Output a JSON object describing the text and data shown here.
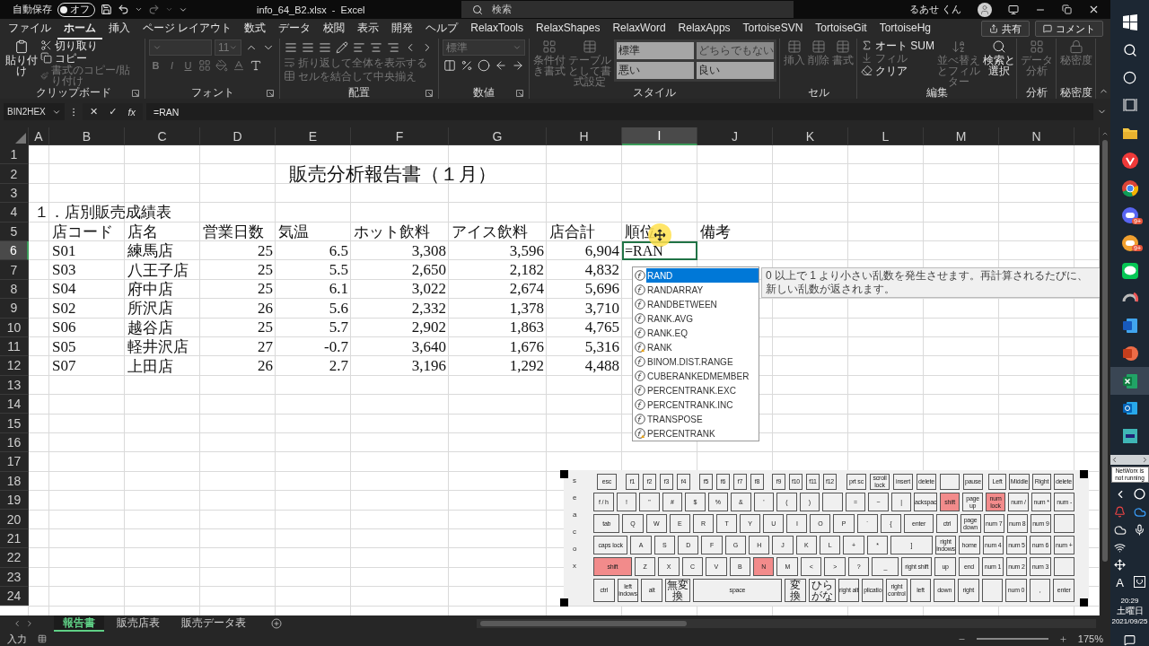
{
  "title_bar": {
    "autosave_label": "自動保存",
    "autosave": {
      "on": false,
      "label": "オフ"
    },
    "title": "info_64_B2.xlsx  -  Excel",
    "search_placeholder": "検索",
    "user": "るあせ くん"
  },
  "ribbon": {
    "tabs": [
      {
        "label": "ファイル",
        "selected": false
      },
      {
        "label": "ホーム",
        "selected": true
      },
      {
        "label": "挿入",
        "selected": false
      },
      {
        "label": "ページ レイアウト",
        "selected": false
      },
      {
        "label": "数式",
        "selected": false
      },
      {
        "label": "データ",
        "selected": false
      },
      {
        "label": "校閲",
        "selected": false
      },
      {
        "label": "表示",
        "selected": false
      },
      {
        "label": "開発",
        "selected": false
      },
      {
        "label": "ヘルプ",
        "selected": false
      },
      {
        "label": "RelaxTools",
        "selected": false
      },
      {
        "label": "RelaxShapes",
        "selected": false
      },
      {
        "label": "RelaxWord",
        "selected": false
      },
      {
        "label": "RelaxApps",
        "selected": false
      },
      {
        "label": "TortoiseSVN",
        "selected": false
      },
      {
        "label": "TortoiseGit",
        "selected": false
      },
      {
        "label": "TortoiseHg",
        "selected": false
      }
    ],
    "share": "共有",
    "comment": "コメント",
    "groups": [
      {
        "label": "クリップボード",
        "items": [
          {
            "kind": "large",
            "label": "貼り付け",
            "disabled": false
          },
          {
            "kind": "small",
            "label": "切り取り",
            "disabled": false
          },
          {
            "kind": "small",
            "label": "コピー",
            "disabled": false
          },
          {
            "kind": "small",
            "label": "書式のコピー/貼り付け",
            "disabled": true
          }
        ]
      },
      {
        "label": "フォント",
        "items": [
          {
            "kind": "field",
            "disabled": true
          },
          {
            "kind": "field",
            "value": "11",
            "disabled": true
          },
          {
            "kind": "icon",
            "disabled": false
          },
          {
            "kind": "icon",
            "disabled": false
          },
          {
            "kind": "text",
            "label": "B",
            "disabled": true
          },
          {
            "kind": "text",
            "label": "I",
            "disabled": true
          },
          {
            "kind": "text",
            "label": "U",
            "disabled": true
          },
          {
            "kind": "icon",
            "disabled": true
          },
          {
            "kind": "icon",
            "disabled": true
          },
          {
            "kind": "icon",
            "disabled": true
          },
          {
            "kind": "icon",
            "disabled": false
          }
        ]
      },
      {
        "label": "配置",
        "items": [
          {
            "kind": "icon",
            "disabled": false
          },
          {
            "kind": "icon",
            "disabled": false
          },
          {
            "kind": "icon",
            "disabled": false
          },
          {
            "kind": "icon",
            "disabled": false
          },
          {
            "kind": "small",
            "label": "折り返して全体を表示する",
            "disabled": true
          },
          {
            "kind": "icon",
            "disabled": false
          },
          {
            "kind": "icon",
            "disabled": false
          },
          {
            "kind": "icon",
            "disabled": false
          },
          {
            "kind": "icon",
            "disabled": false
          },
          {
            "kind": "icon",
            "disabled": false
          },
          {
            "kind": "small",
            "label": "セルを結合して中央揃え",
            "disabled": true
          }
        ]
      },
      {
        "label": "数値",
        "items": [
          {
            "kind": "field",
            "value": "標準",
            "disabled": true
          },
          {
            "kind": "icon",
            "disabled": false
          },
          {
            "kind": "icon",
            "disabled": false
          },
          {
            "kind": "icon",
            "disabled": false
          },
          {
            "kind": "icon",
            "disabled": false
          },
          {
            "kind": "icon",
            "disabled": false
          }
        ]
      },
      {
        "label": "スタイル",
        "items": [
          {
            "kind": "large",
            "label": "条件付き書式",
            "disabled": true
          },
          {
            "kind": "large",
            "label": "テーブルとして書式設定",
            "disabled": true
          },
          {
            "kind": "style",
            "label": "標準",
            "disabled": false
          },
          {
            "kind": "style",
            "label": "どちらでもない",
            "disabled": true
          },
          {
            "kind": "style",
            "label": "悪い",
            "disabled": false
          },
          {
            "kind": "style",
            "label": "良い",
            "disabled": false
          }
        ]
      },
      {
        "label": "セル",
        "items": [
          {
            "kind": "large",
            "label": "挿入",
            "disabled": true
          },
          {
            "kind": "large",
            "label": "削除",
            "disabled": true
          },
          {
            "kind": "large",
            "label": "書式",
            "disabled": true
          }
        ]
      },
      {
        "label": "編集",
        "items": [
          {
            "kind": "small",
            "label": "オート SUM",
            "disabled": false
          },
          {
            "kind": "small",
            "label": "フィル",
            "disabled": true
          },
          {
            "kind": "small",
            "label": "クリア",
            "disabled": false
          },
          {
            "kind": "large",
            "label": "並べ替えとフィルター",
            "disabled": true
          },
          {
            "kind": "large",
            "label": "検索と選択",
            "disabled": false
          }
        ]
      },
      {
        "label": "分析",
        "items": [
          {
            "kind": "large",
            "label": "データ分析",
            "disabled": true
          }
        ]
      },
      {
        "label": "秘密度",
        "items": [
          {
            "kind": "large",
            "label": "秘密度",
            "disabled": true
          }
        ]
      }
    ]
  },
  "formula_bar": {
    "name_box": "BIN2HEX",
    "cancel": "✕",
    "enter": "✓",
    "function": "fx",
    "formula": "=RAN"
  },
  "sheet": {
    "columns": [
      {
        "label": "A",
        "selected": false
      },
      {
        "label": "B",
        "selected": false
      },
      {
        "label": "C",
        "selected": false
      },
      {
        "label": "D",
        "selected": false
      },
      {
        "label": "E",
        "selected": false
      },
      {
        "label": "F",
        "selected": false
      },
      {
        "label": "G",
        "selected": false
      },
      {
        "label": "H",
        "selected": false
      },
      {
        "label": "I",
        "selected": true
      },
      {
        "label": "J",
        "selected": false
      },
      {
        "label": "K",
        "selected": false
      },
      {
        "label": "L",
        "selected": false
      },
      {
        "label": "M",
        "selected": false
      },
      {
        "label": "N",
        "selected": false
      }
    ],
    "rows": [
      {
        "number": "1",
        "kind": "empty",
        "selected": false
      },
      {
        "number": "2",
        "kind": "title",
        "selected": false,
        "E": "販売分析報告書（１月）"
      },
      {
        "number": "3",
        "kind": "empty",
        "selected": false
      },
      {
        "number": "4",
        "kind": "section",
        "selected": false,
        "A": "１．店別販売成績表"
      },
      {
        "number": "5",
        "kind": "header",
        "selected": false,
        "B": "店コード",
        "C": "店名",
        "D": "営業日数",
        "E": "気温",
        "F": "ホット飲料",
        "G": "アイス飲料",
        "H": "店合計",
        "I": "順位",
        "J": "備考"
      },
      {
        "number": "6",
        "kind": "data",
        "selected": true,
        "B": "S01",
        "C": "練馬店",
        "D": "25",
        "E": "6.5",
        "F": "3,308",
        "G": "3,596",
        "H": "6,904",
        "I": "=RAN"
      },
      {
        "number": "7",
        "kind": "data",
        "selected": false,
        "B": "S03",
        "C": "八王子店",
        "D": "25",
        "E": "5.5",
        "F": "2,650",
        "G": "2,182",
        "H": "4,832"
      },
      {
        "number": "8",
        "kind": "data",
        "selected": false,
        "B": "S04",
        "C": "府中店",
        "D": "25",
        "E": "6.1",
        "F": "3,022",
        "G": "2,674",
        "H": "5,696"
      },
      {
        "number": "9",
        "kind": "data",
        "selected": false,
        "B": "S02",
        "C": "所沢店",
        "D": "26",
        "E": "5.6",
        "F": "2,332",
        "G": "1,378",
        "H": "3,710"
      },
      {
        "number": "10",
        "kind": "data",
        "selected": false,
        "B": "S06",
        "C": "越谷店",
        "D": "25",
        "E": "5.7",
        "F": "2,902",
        "G": "1,863",
        "H": "4,765"
      },
      {
        "number": "11",
        "kind": "data",
        "selected": false,
        "B": "S05",
        "C": "軽井沢店",
        "D": "27",
        "E": "-0.7",
        "F": "3,640",
        "G": "1,676",
        "H": "5,316"
      },
      {
        "number": "12",
        "kind": "data",
        "selected": false,
        "B": "S07",
        "C": "上田店",
        "D": "26",
        "E": "2.7",
        "F": "3,196",
        "G": "1,292",
        "H": "4,488"
      },
      {
        "number": "13",
        "kind": "empty",
        "selected": false
      },
      {
        "number": "14",
        "kind": "empty",
        "selected": false
      },
      {
        "number": "15",
        "kind": "empty",
        "selected": false
      },
      {
        "number": "16",
        "kind": "empty",
        "selected": false
      },
      {
        "number": "17",
        "kind": "empty",
        "selected": false
      },
      {
        "number": "18",
        "kind": "empty",
        "selected": false
      },
      {
        "number": "19",
        "kind": "empty",
        "selected": false
      },
      {
        "number": "20",
        "kind": "empty",
        "selected": false
      },
      {
        "number": "21",
        "kind": "empty",
        "selected": false
      },
      {
        "number": "22",
        "kind": "empty",
        "selected": false
      },
      {
        "number": "23",
        "kind": "empty",
        "selected": false
      },
      {
        "number": "24",
        "kind": "empty",
        "selected": false
      }
    ]
  },
  "autocomplete": {
    "items": [
      {
        "label": "RAND",
        "kind": "function",
        "selected": true
      },
      {
        "label": "RANDARRAY",
        "kind": "function",
        "selected": false
      },
      {
        "label": "RANDBETWEEN",
        "kind": "function",
        "selected": false
      },
      {
        "label": "RANK.AVG",
        "kind": "function",
        "selected": false
      },
      {
        "label": "RANK.EQ",
        "kind": "function",
        "selected": false
      },
      {
        "label": "RANK",
        "kind": "compat",
        "selected": false
      },
      {
        "label": "BINOM.DIST.RANGE",
        "kind": "function",
        "selected": false
      },
      {
        "label": "CUBERANKEDMEMBER",
        "kind": "function",
        "selected": false
      },
      {
        "label": "PERCENTRANK.EXC",
        "kind": "function",
        "selected": false
      },
      {
        "label": "PERCENTRANK.INC",
        "kind": "function",
        "selected": false
      },
      {
        "label": "TRANSPOSE",
        "kind": "function",
        "selected": false
      },
      {
        "label": "PERCENTRANK",
        "kind": "compat",
        "selected": false
      }
    ],
    "tooltip": "0 以上で 1 より小さい乱数を発生させます。再計算されるたびに、新しい乱数が返されます。"
  },
  "keyboard": {
    "side_letters": [
      "s",
      "e",
      "a",
      "c",
      "o",
      "x"
    ],
    "rows": [
      {
        "keys": [
          {
            "label": "esc",
            "pressed": false
          },
          {
            "label": "f1",
            "pressed": false
          },
          {
            "label": "f2",
            "pressed": false
          },
          {
            "label": "f3",
            "pressed": false
          },
          {
            "label": "f4",
            "pressed": false
          },
          {
            "label": "f5",
            "pressed": false
          },
          {
            "label": "f6",
            "pressed": false
          },
          {
            "label": "f7",
            "pressed": false
          },
          {
            "label": "f8",
            "pressed": false
          },
          {
            "label": "f9",
            "pressed": false
          },
          {
            "label": "f10",
            "pressed": false
          },
          {
            "label": "f11",
            "pressed": false
          },
          {
            "label": "f12",
            "pressed": false
          },
          {
            "label": "prt sc",
            "pressed": false
          },
          {
            "label": "scroll lock",
            "pressed": false
          },
          {
            "label": "insert",
            "pressed": false
          },
          {
            "label": "delete",
            "pressed": false
          },
          {
            "pressed": false
          },
          {
            "label": "pause",
            "pressed": false
          },
          {
            "label": "Left",
            "pressed": false
          },
          {
            "label": "Middle",
            "pressed": false
          },
          {
            "label": "Right",
            "pressed": false
          },
          {
            "label": "delete",
            "pressed": false
          }
        ]
      },
      {
        "keys": [
          {
            "label": "f / h",
            "pressed": false
          },
          {
            "label": "!",
            "pressed": false
          },
          {
            "label": "\"",
            "pressed": false
          },
          {
            "label": "#",
            "pressed": false
          },
          {
            "label": "$",
            "pressed": false
          },
          {
            "label": "%",
            "pressed": false
          },
          {
            "label": "&",
            "pressed": false
          },
          {
            "label": "'",
            "pressed": false
          },
          {
            "label": "(",
            "pressed": false
          },
          {
            "label": ")",
            "pressed": false
          },
          {
            "pressed": false
          },
          {
            "label": "=",
            "pressed": false
          },
          {
            "label": "~",
            "pressed": false
          },
          {
            "label": "|",
            "pressed": false
          },
          {
            "label": "ackspac",
            "pressed": false
          },
          {
            "label": "shift",
            "pressed": true
          },
          {
            "label": "page up",
            "pressed": false
          },
          {
            "label": "num lock",
            "pressed": true
          },
          {
            "label": "num /",
            "pressed": false
          },
          {
            "label": "num *",
            "pressed": false
          },
          {
            "label": "num -",
            "pressed": false
          }
        ]
      },
      {
        "keys": [
          {
            "label": "tab",
            "pressed": false
          },
          {
            "label": "Q",
            "pressed": false
          },
          {
            "label": "W",
            "pressed": false
          },
          {
            "label": "E",
            "pressed": false
          },
          {
            "label": "R",
            "pressed": false
          },
          {
            "label": "T",
            "pressed": false
          },
          {
            "label": "Y",
            "pressed": false
          },
          {
            "label": "U",
            "pressed": false
          },
          {
            "label": "I",
            "pressed": false
          },
          {
            "label": "O",
            "pressed": false
          },
          {
            "label": "P",
            "pressed": false
          },
          {
            "label": "`",
            "pressed": false
          },
          {
            "label": "{",
            "pressed": false
          },
          {
            "label": "enter",
            "pressed": false
          },
          {
            "label": "ctrl",
            "pressed": false
          },
          {
            "label": "page down",
            "pressed": false
          },
          {
            "label": "num 7",
            "pressed": false
          },
          {
            "label": "num 8",
            "pressed": false
          },
          {
            "label": "num 9",
            "pressed": false
          },
          {
            "pressed": false
          }
        ]
      },
      {
        "keys": [
          {
            "label": "caps lock",
            "pressed": false
          },
          {
            "label": "A",
            "pressed": false
          },
          {
            "label": "S",
            "pressed": false
          },
          {
            "label": "D",
            "pressed": false
          },
          {
            "label": "F",
            "pressed": false
          },
          {
            "label": "G",
            "pressed": false
          },
          {
            "label": "H",
            "pressed": false
          },
          {
            "label": "J",
            "pressed": false
          },
          {
            "label": "K",
            "pressed": false
          },
          {
            "label": "L",
            "pressed": false
          },
          {
            "label": "+",
            "pressed": false
          },
          {
            "label": "*",
            "pressed": false
          },
          {
            "label": "]",
            "pressed": false
          },
          {
            "label": "right indows",
            "pressed": false
          },
          {
            "label": "home",
            "pressed": false
          },
          {
            "label": "num 4",
            "pressed": false
          },
          {
            "label": "num 5",
            "pressed": false
          },
          {
            "label": "num 6",
            "pressed": false
          },
          {
            "label": "num +",
            "pressed": false
          }
        ]
      },
      {
        "keys": [
          {
            "label": "shift",
            "pressed": true
          },
          {
            "label": "Z",
            "pressed": false
          },
          {
            "label": "X",
            "pressed": false
          },
          {
            "label": "C",
            "pressed": false
          },
          {
            "label": "V",
            "pressed": false
          },
          {
            "label": "B",
            "pressed": false
          },
          {
            "label": "N",
            "pressed": true
          },
          {
            "label": "M",
            "pressed": false
          },
          {
            "label": "<",
            "pressed": false
          },
          {
            "label": ">",
            "pressed": false
          },
          {
            "label": "?",
            "pressed": false
          },
          {
            "label": "_",
            "pressed": false
          },
          {
            "label": "right shift",
            "pressed": false
          },
          {
            "label": "up",
            "pressed": false
          },
          {
            "label": "end",
            "pressed": false
          },
          {
            "label": "num 1",
            "pressed": false
          },
          {
            "label": "num 2",
            "pressed": false
          },
          {
            "label": "num 3",
            "pressed": false
          },
          {
            "pressed": false
          }
        ]
      },
      {
        "keys": [
          {
            "label": "ctrl",
            "pressed": false
          },
          {
            "label": "left indows",
            "pressed": false
          },
          {
            "label": "alt",
            "pressed": false
          },
          {
            "label": "無変換",
            "pressed": false
          },
          {
            "label": "space",
            "pressed": false
          },
          {
            "label": "変換",
            "pressed": false
          },
          {
            "label": "ひらがな",
            "pressed": false
          },
          {
            "label": "right alt",
            "pressed": false
          },
          {
            "label": "plicatio",
            "pressed": false
          },
          {
            "label": "right control",
            "pressed": false
          },
          {
            "label": "left",
            "pressed": false
          },
          {
            "label": "down",
            "pressed": false
          },
          {
            "label": "right",
            "pressed": false
          },
          {
            "pressed": false
          },
          {
            "label": "num 0",
            "pressed": false
          },
          {
            "label": ",",
            "pressed": false
          },
          {
            "label": "enter",
            "pressed": false
          }
        ]
      }
    ]
  },
  "sheet_tabs": [
    {
      "label": "報告書",
      "selected": true
    },
    {
      "label": "販売店表",
      "selected": false
    },
    {
      "label": "販売データ表",
      "selected": false
    }
  ],
  "status_bar": {
    "mode": "入力",
    "zoom": "175%"
  },
  "taskbar": {
    "apps": [
      {
        "kind": "start",
        "selected": false
      },
      {
        "kind": "search",
        "selected": false
      },
      {
        "kind": "assistant",
        "selected": false
      },
      {
        "kind": "taskview",
        "selected": false
      },
      {
        "kind": "folder",
        "selected": false
      },
      {
        "kind": "redbrowser",
        "selected": false
      },
      {
        "kind": "browser",
        "selected": false
      },
      {
        "kind": "chat",
        "selected": false,
        "badge": "9+"
      },
      {
        "kind": "chat2",
        "selected": false,
        "badge": "9+"
      },
      {
        "kind": "messenger",
        "selected": false
      },
      {
        "kind": "tool",
        "selected": false
      },
      {
        "kind": "doc",
        "selected": false
      },
      {
        "kind": "slides",
        "selected": false
      },
      {
        "kind": "sheet",
        "selected": true
      },
      {
        "kind": "mail",
        "selected": false
      },
      {
        "kind": "app",
        "selected": false
      }
    ],
    "tray_tooltip": "NetWorx is not running",
    "input_mode": "A",
    "time": "20:29",
    "day": "土曜日",
    "date": "2021/09/25"
  }
}
